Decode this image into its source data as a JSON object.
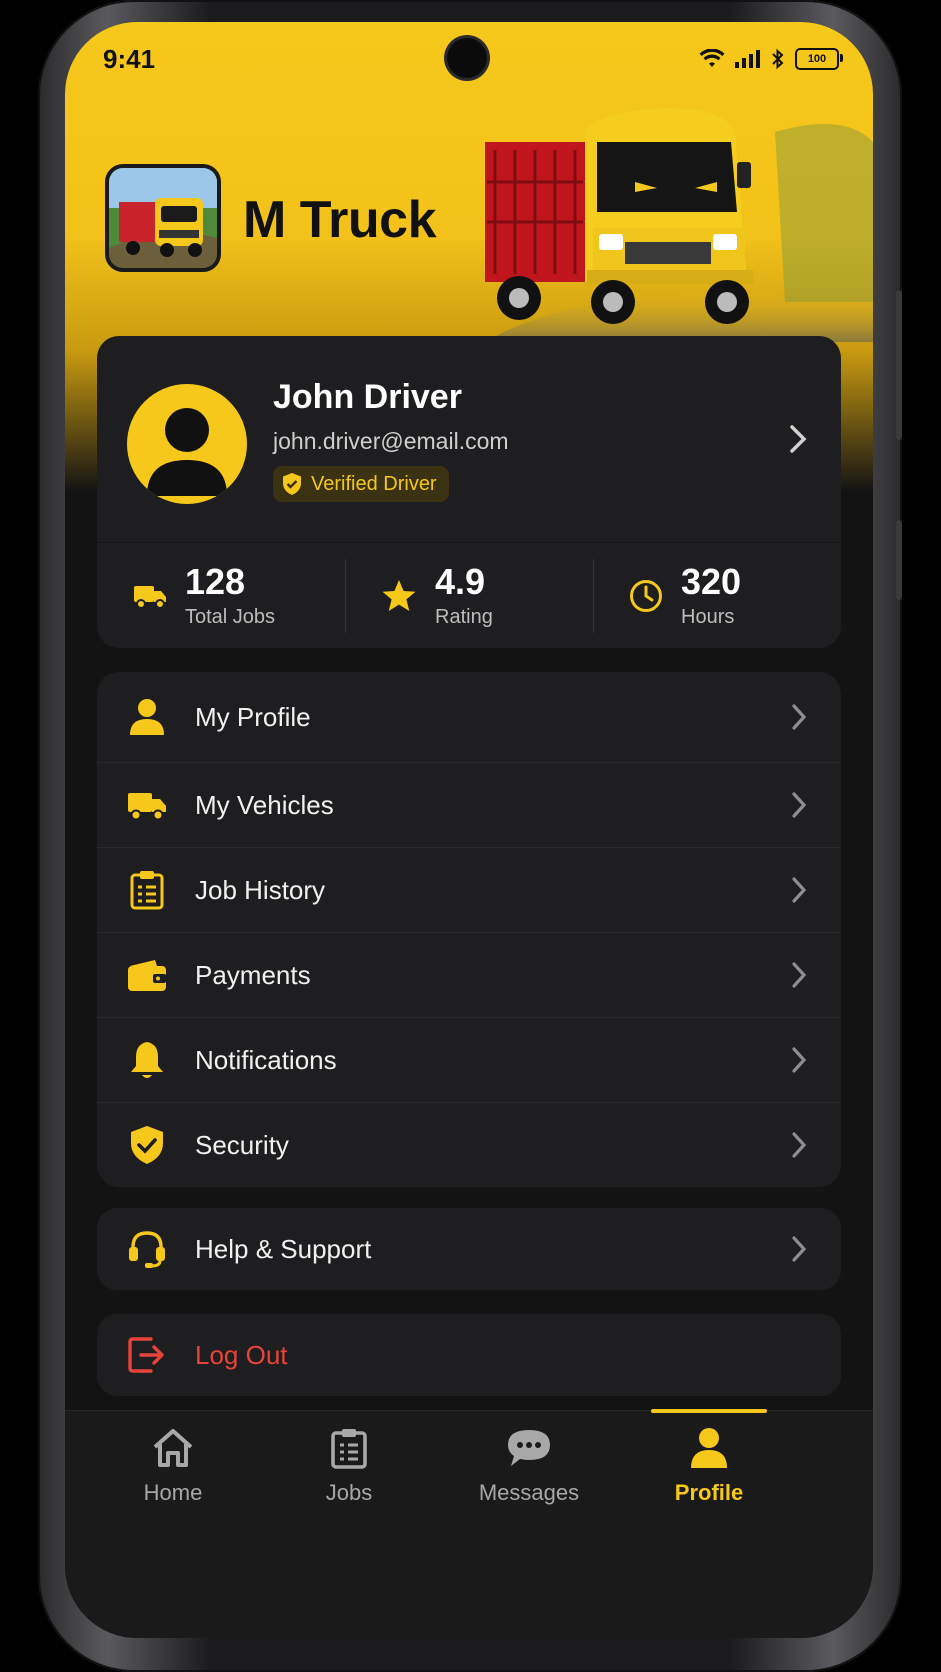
{
  "status_bar": {
    "time": "9:41",
    "battery": "100"
  },
  "app": {
    "title": "M Truck"
  },
  "profile": {
    "name": "John Driver",
    "email": "john.driver@email.com",
    "badge": "Verified Driver"
  },
  "stats": [
    {
      "value": "128",
      "label": "Total Jobs",
      "icon": "truck-icon"
    },
    {
      "value": "4.9",
      "label": "Rating",
      "icon": "star-icon"
    },
    {
      "value": "320",
      "label": "Hours",
      "icon": "clock-icon"
    }
  ],
  "menu": {
    "items": [
      {
        "label": "My Profile",
        "icon": "user-icon"
      },
      {
        "label": "My Vehicles",
        "icon": "truck-icon"
      },
      {
        "label": "Job History",
        "icon": "clipboard-icon"
      },
      {
        "label": "Payments",
        "icon": "wallet-icon"
      },
      {
        "label": "Notifications",
        "icon": "bell-icon"
      },
      {
        "label": "Security",
        "icon": "shield-check-icon"
      }
    ],
    "help": "Help & Support",
    "logout": "Log Out"
  },
  "nav": {
    "items": [
      {
        "label": "Home",
        "icon": "home-icon"
      },
      {
        "label": "Jobs",
        "icon": "clipboard-icon"
      },
      {
        "label": "Messages",
        "icon": "chat-icon"
      },
      {
        "label": "Profile",
        "icon": "user-icon"
      }
    ],
    "active": "Profile"
  },
  "colors": {
    "accent": "#f6c81b",
    "background": "#131314",
    "card": "#1e1e20",
    "danger": "#e8433a"
  }
}
